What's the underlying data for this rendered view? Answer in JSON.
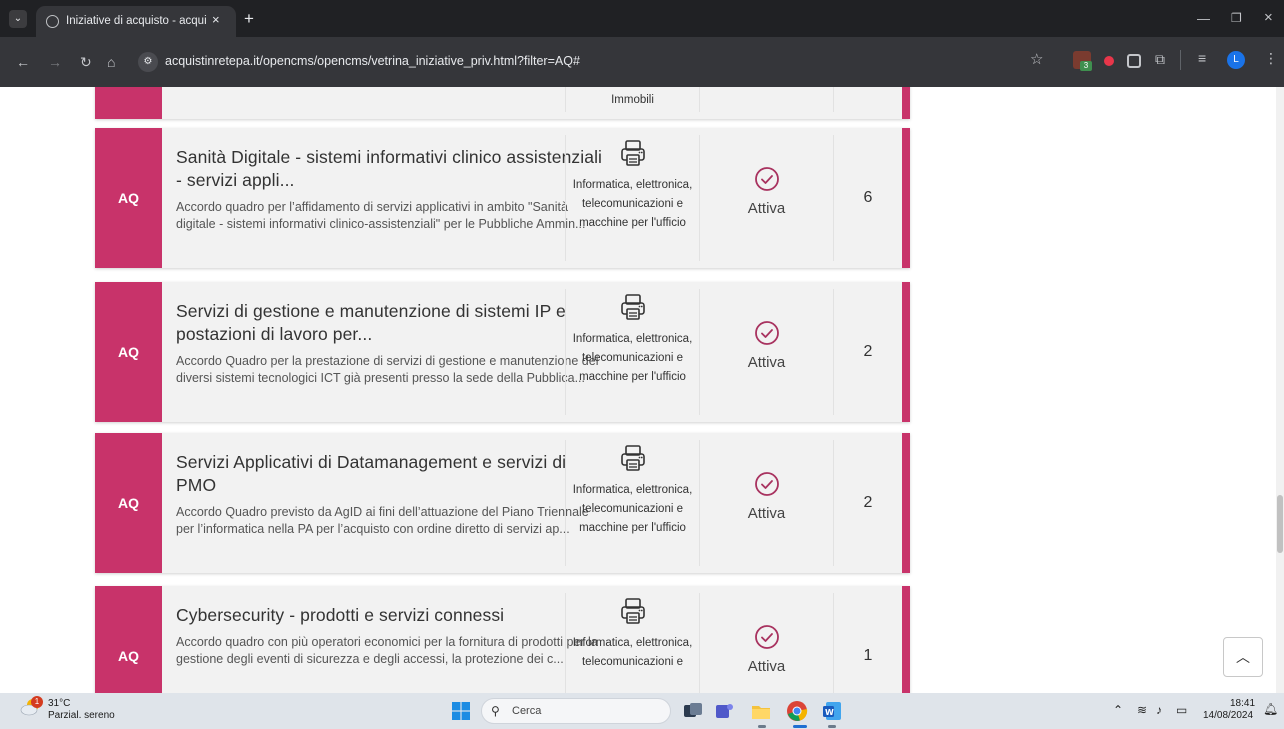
{
  "browser": {
    "tab_title": "Iniziative di acquisto - acquistin",
    "tab_close": "×",
    "new_tab": "+",
    "url": "acquistinretepa.it/opencms/opencms/vetrina_iniziative_priv.html?filter=AQ#",
    "extension_badge": "3",
    "profile_initial": "L"
  },
  "page": {
    "partial_row_category": "Immobili",
    "cards": [
      {
        "type": "AQ",
        "title": "Sanità Digitale - sistemi informativi clinico assistenziali - servizi appli...",
        "description": "Accordo quadro per l’affidamento di servizi applicativi in ambito \"Sanità digitale - sistemi informativi clinico-assistenziali\" per le Pubbliche Ammin...",
        "category": "Informatica, elettronica, telecomunicazioni e macchine per l'ufficio",
        "status": "Attiva",
        "count": "6"
      },
      {
        "type": "AQ",
        "title": "Servizi di gestione e manutenzione di sistemi IP e postazioni di lavoro per...",
        "description": "Accordo Quadro per la prestazione di servizi di gestione e manutenzione dei diversi sistemi tecnologici ICT già presenti presso la sede della Pubblica...",
        "category": "Informatica, elettronica, telecomunicazioni e macchine per l'ufficio",
        "status": "Attiva",
        "count": "2"
      },
      {
        "type": "AQ",
        "title": "Servizi Applicativi di Datamanagement e servizi di PMO",
        "description": "Accordo Quadro previsto da AgID ai fini dell’attuazione del Piano Triennale per l’informatica nella PA per l’acquisto con ordine diretto di servizi ap...",
        "category": "Informatica, elettronica, telecomunicazioni e macchine per l'ufficio",
        "status": "Attiva",
        "count": "2"
      },
      {
        "type": "AQ",
        "title": "Cybersecurity - prodotti e servizi connessi",
        "description": "Accordo quadro con più operatori economici per la fornitura di prodotti per la gestione degli eventi di sicurezza e degli accessi, la protezione dei c...",
        "category": "Informatica, elettronica, telecomunicazioni e",
        "status": "Attiva",
        "count": "1"
      }
    ]
  },
  "taskbar": {
    "weather_badge": "1",
    "temperature": "31°C",
    "weather": "Parzial. sereno",
    "search_label": "Cerca",
    "time": "18:41",
    "date": "14/08/2024"
  },
  "colors": {
    "accent": "#c8336a",
    "card_background": "#f2f2f2",
    "tab_strip": "#202124",
    "toolbar": "#35363a",
    "taskbar": "#dfe4ea"
  },
  "icons": {
    "category": "printer-icon",
    "status": "check-circle-icon",
    "back_to_top": "chevron-up-icon"
  }
}
